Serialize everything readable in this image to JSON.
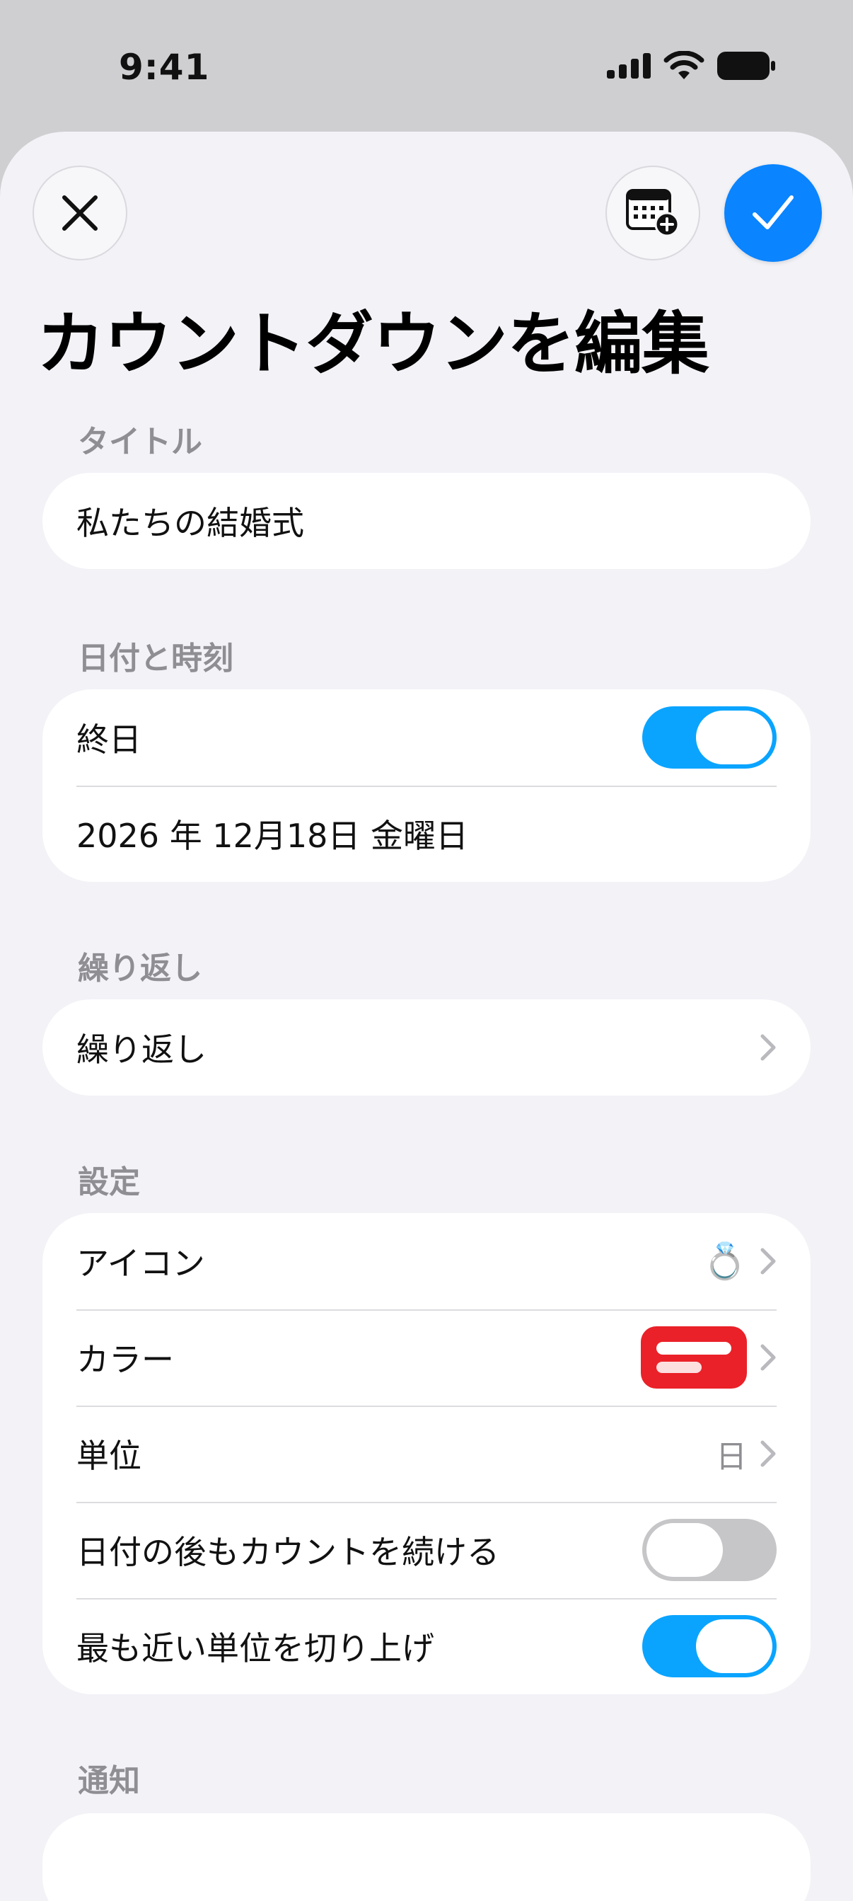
{
  "status": {
    "time": "9:41"
  },
  "header": {
    "title": "カウントダウンを編集"
  },
  "sections": {
    "title": {
      "header": "タイトル",
      "value": "私たちの結婚式"
    },
    "datetime": {
      "header": "日付と時刻",
      "all_day_label": "終日",
      "all_day_on": true,
      "date": "2026 年 12月18日 金曜日"
    },
    "repeat": {
      "header": "繰り返し",
      "label": "繰り返し"
    },
    "settings": {
      "header": "設定",
      "icon_label": "アイコン",
      "icon_value": "💍",
      "color_label": "カラー",
      "color_hex": "#ea2128",
      "unit_label": "単位",
      "unit_value": "日",
      "continue_label": "日付の後もカウントを続ける",
      "continue_on": false,
      "roundup_label": "最も近い単位を切り上げ",
      "roundup_on": true
    },
    "notification": {
      "header": "通知"
    }
  },
  "colors": {
    "accent": "#0a84ff",
    "toggle_on": "#0aa4ff",
    "toggle_off": "#c6c6c8"
  },
  "icons": [
    "close-icon",
    "calendar-add-icon",
    "checkmark-icon",
    "chevron-right-icon",
    "ring-icon"
  ]
}
